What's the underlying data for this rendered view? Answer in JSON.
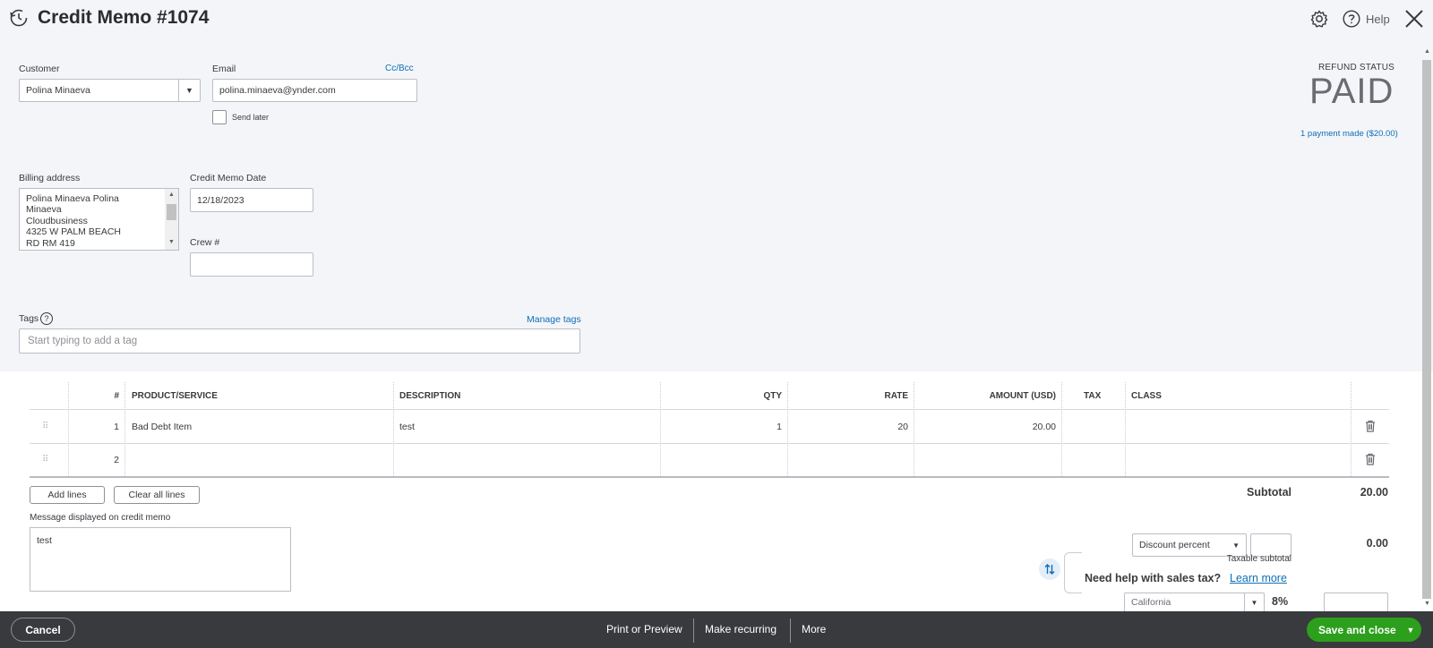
{
  "header": {
    "title": "Credit Memo #1074",
    "help_label": "Help",
    "icons": [
      "history-icon",
      "gear-icon",
      "help-circle-icon",
      "close-icon"
    ]
  },
  "form": {
    "customer_label": "Customer",
    "customer_value": "Polina Minaeva",
    "email_label": "Email",
    "email_value": "polina.minaeva@ynder.com",
    "cc_bcc_label": "Cc/Bcc",
    "send_later_label": "Send later",
    "billing_label": "Billing address",
    "billing_lines": [
      "Polina Minaeva Polina",
      "Minaeva",
      "Cloudbusiness",
      "4325 W PALM BEACH",
      "RD RM 419"
    ],
    "date_label": "Credit Memo Date",
    "date_value": "12/18/2023",
    "crew_label": "Crew #",
    "crew_value": "",
    "tags_label": "Tags",
    "manage_tags_label": "Manage tags",
    "tags_placeholder": "Start typing to add a tag"
  },
  "status": {
    "label": "REFUND STATUS",
    "value": "PAID",
    "payment_link": "1 payment made ($20.00)"
  },
  "table": {
    "headers": {
      "num": "#",
      "product": "PRODUCT/SERVICE",
      "description": "DESCRIPTION",
      "qty": "QTY",
      "rate": "RATE",
      "amount": "AMOUNT (USD)",
      "tax": "TAX",
      "class": "CLASS"
    },
    "rows": [
      {
        "num": "1",
        "product": "Bad Debt Item",
        "description": "test",
        "qty": "1",
        "rate": "20",
        "amount": "20.00",
        "tax": "",
        "class": ""
      },
      {
        "num": "2",
        "product": "",
        "description": "",
        "qty": "",
        "rate": "",
        "amount": "",
        "tax": "",
        "class": ""
      }
    ]
  },
  "actions": {
    "add_lines": "Add lines",
    "clear_all_lines": "Clear all lines"
  },
  "message": {
    "label": "Message displayed on credit memo",
    "value": "test"
  },
  "totals": {
    "subtotal_label": "Subtotal",
    "subtotal_value": "20.00",
    "discount_select": "Discount percent",
    "discount_input": "",
    "discount_value": "0.00",
    "taxable_subtotal_label": "Taxable subtotal",
    "sales_tax_prompt": "Need help with sales tax?",
    "learn_more": "Learn more",
    "tax_region": "California",
    "tax_rate": "8%",
    "tax_amount": ""
  },
  "footer": {
    "cancel": "Cancel",
    "print_preview": "Print or Preview",
    "make_recurring": "Make recurring",
    "more": "More",
    "save_close": "Save and close"
  },
  "colors": {
    "accent_link": "#0d6fb8",
    "save_green": "#2ca01c",
    "footer_bg": "#393a3d",
    "top_bg": "#f4f5f8"
  }
}
